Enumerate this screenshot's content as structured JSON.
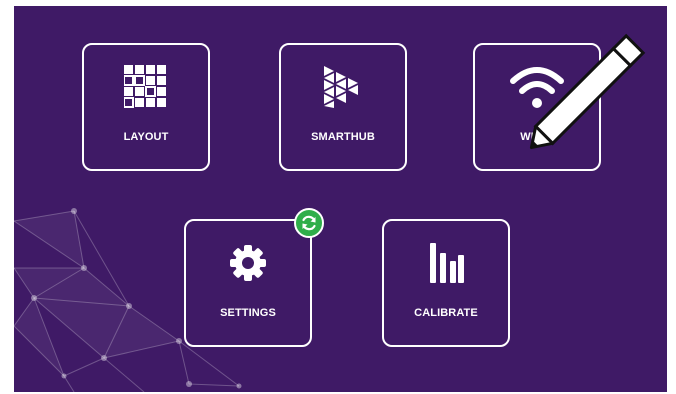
{
  "app": {
    "background_color": "#3f1a66",
    "tile_border_color": "#ffffff",
    "badge_color": "#2fae4a"
  },
  "tiles": [
    {
      "label": "LAYOUT",
      "icon": "grid-icon"
    },
    {
      "label": "SMARTHUB",
      "icon": "smarthub-logo-icon"
    },
    {
      "label": "WLAN",
      "icon": "wifi-icon"
    },
    {
      "label": "SETTINGS",
      "icon": "gear-icon"
    },
    {
      "label": "CALIBRATE",
      "icon": "bar-chart-icon"
    }
  ],
  "badges": {
    "settings": {
      "icon": "sync-icon"
    }
  },
  "cursor": {
    "icon": "pencil-icon"
  }
}
